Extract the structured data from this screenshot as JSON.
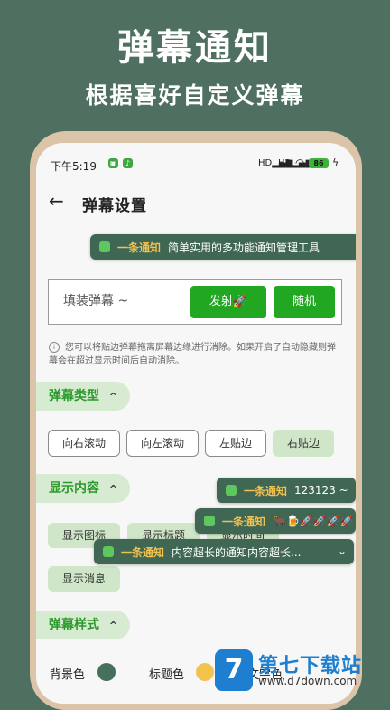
{
  "hero": {
    "title": "弹幕通知",
    "subtitle": "根据喜好自定义弹幕"
  },
  "status": {
    "time": "下午5:19",
    "sig1": "HD",
    "sig2": "HD",
    "battery": "86"
  },
  "header": {
    "title": "弹幕设置"
  },
  "app_name": "一条通知",
  "toasts": [
    {
      "name": "一条通知",
      "text": "简单实用的多功能通知管理工具"
    },
    {
      "name": "一条通知",
      "text": "123123 ~"
    },
    {
      "name": "一条通知",
      "text": "🐂🍺🚀🚀🚀🚀"
    },
    {
      "name": "一条通知",
      "text": "内容超长的通知内容超长..."
    }
  ],
  "input": {
    "placeholder": "填装弹幕 ~",
    "fire_label": "发射🚀",
    "random_label": "随机"
  },
  "hint": "您可以将贴边弹幕拖离屏幕边缘进行消除。如果开启了自动隐藏则弹幕会在超过显示时间后自动消除。",
  "sections": {
    "type": {
      "label": "弹幕类型",
      "chevron": "^",
      "options": [
        "向右滚动",
        "向左滚动",
        "左贴边",
        "右贴边"
      ],
      "selected": "右贴边"
    },
    "content": {
      "label": "显示内容",
      "chevron": "^",
      "options": [
        "显示图标",
        "显示标题",
        "显示消息",
        "显示时间"
      ]
    },
    "style": {
      "label": "弹幕样式",
      "chevron": "^",
      "bg_label": "背景色",
      "title_label": "标题色",
      "text_label": "文字色"
    }
  },
  "colors": {
    "bg": "#46705e",
    "title": "#f2c14e",
    "accent": "#22a722"
  },
  "watermark": {
    "logo": "7",
    "name": "第七下载站",
    "url": "www.d7down.com"
  }
}
